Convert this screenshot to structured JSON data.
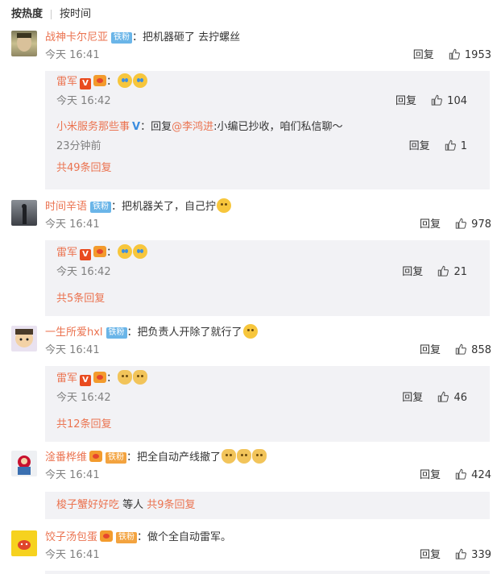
{
  "sort": {
    "by_hot": "按热度",
    "by_time": "按时间"
  },
  "labels": {
    "reply": "回复",
    "iron_fan": "铁粉"
  },
  "comments": [
    {
      "user": "战神卡尔尼亚",
      "text": "：把机器砸了 去拧螺丝",
      "time": "今天 16:41",
      "likes": "1953",
      "replies": [
        {
          "user": "雷军",
          "text": "：",
          "time": "今天 16:42",
          "likes": "104"
        },
        {
          "user": "小米服务那些事",
          "text_pre": "：回复",
          "mention": "@李鸿进",
          "text_post": ":小编已抄收，咱们私信聊～",
          "time": "23分钟前",
          "likes": "1"
        }
      ],
      "more": "共49条回复"
    },
    {
      "user": "时间辛语",
      "text": "：把机器关了，自己拧",
      "time": "今天 16:41",
      "likes": "978",
      "replies": [
        {
          "user": "雷军",
          "text": "：",
          "time": "今天 16:42",
          "likes": "21"
        }
      ],
      "more": "共5条回复"
    },
    {
      "user": "一生所爱hxl",
      "text": "：把负责人开除了就行了",
      "time": "今天 16:41",
      "likes": "858",
      "replies": [
        {
          "user": "雷军",
          "text": "：",
          "time": "今天 16:42",
          "likes": "46"
        }
      ],
      "more": "共12条回复"
    },
    {
      "user": "淦番桦维",
      "text": "：把全自动产线撤了",
      "time": "今天 16:41",
      "likes": "424",
      "more_user": "梭子蟹好好吃",
      "more_mid": " 等人 ",
      "more": "共9条回复"
    },
    {
      "user": "饺子汤包蛋",
      "text": "：做个全自动雷军。",
      "time": "今天 16:41",
      "likes": "339"
    }
  ]
}
